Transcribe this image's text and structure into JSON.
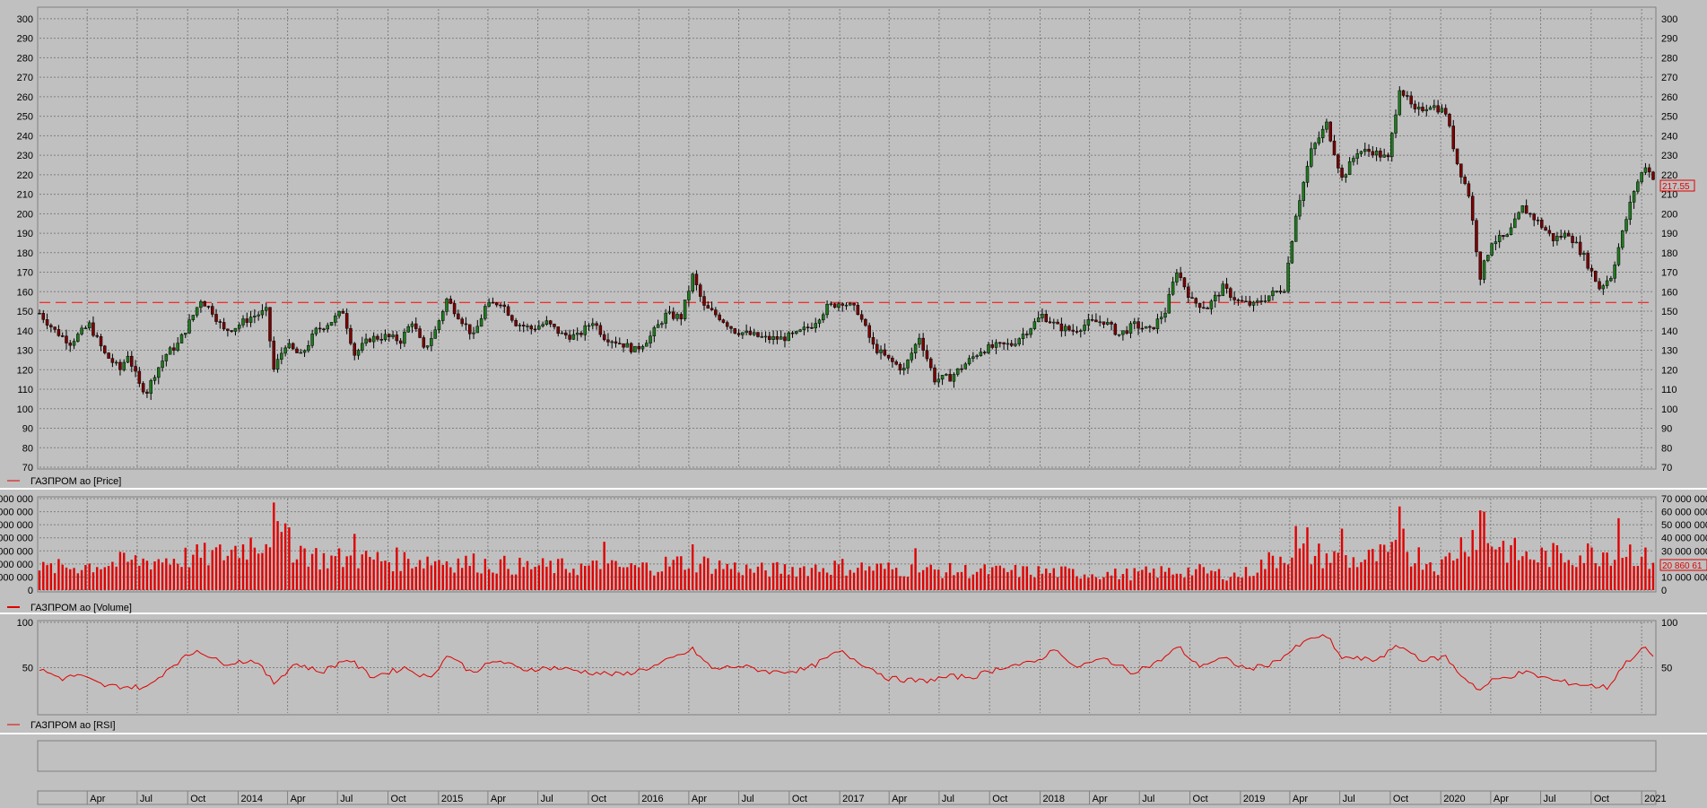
{
  "colors": {
    "background": "#c0c0c0",
    "panel": "#c0c0c0",
    "grid": "#7f7f7f",
    "candle_up": "#1f7a1f",
    "candle_down": "#7a0000",
    "wick": "#000000",
    "volume": "#e00000",
    "rsi_line": "#e00000",
    "reference_line": "#ff0000",
    "last_value": "#e00000"
  },
  "chart_data": [
    {
      "type": "candlestick",
      "name": "ГАЗПРОМ ао [Price]",
      "legend": "ГАЗПРОМ ао [Price]",
      "ylim": [
        70,
        305
      ],
      "yticks": [
        70,
        80,
        90,
        100,
        110,
        120,
        130,
        140,
        150,
        160,
        170,
        180,
        190,
        200,
        210,
        220,
        230,
        240,
        250,
        260,
        270,
        280,
        290,
        300
      ],
      "reference_line": 154.5,
      "last_value_label": "217.55",
      "x_dates": [
        "2013-01-04",
        "2021-01-22"
      ],
      "close_path": [
        [
          "2013-01-04",
          149
        ],
        [
          "2013-02-01",
          140
        ],
        [
          "2013-03-01",
          134
        ],
        [
          "2013-04-05",
          143
        ],
        [
          "2013-05-03",
          128
        ],
        [
          "2013-05-31",
          120
        ],
        [
          "2013-06-14",
          128
        ],
        [
          "2013-07-05",
          112
        ],
        [
          "2013-07-19",
          109
        ],
        [
          "2013-08-02",
          118
        ],
        [
          "2013-08-23",
          128
        ],
        [
          "2013-09-13",
          133
        ],
        [
          "2013-10-11",
          148
        ],
        [
          "2013-10-25",
          156
        ],
        [
          "2013-11-15",
          150
        ],
        [
          "2013-12-06",
          140
        ],
        [
          "2013-12-27",
          142
        ],
        [
          "2014-01-24",
          147
        ],
        [
          "2014-02-21",
          150
        ],
        [
          "2014-03-07",
          120
        ],
        [
          "2014-03-28",
          133
        ],
        [
          "2014-04-25",
          127
        ],
        [
          "2014-05-23",
          140
        ],
        [
          "2014-06-20",
          145
        ],
        [
          "2014-07-11",
          150
        ],
        [
          "2014-08-01",
          128
        ],
        [
          "2014-08-29",
          136
        ],
        [
          "2014-09-26",
          137
        ],
        [
          "2014-10-24",
          135
        ],
        [
          "2014-11-14",
          145
        ],
        [
          "2014-12-05",
          130
        ],
        [
          "2014-12-26",
          140
        ],
        [
          "2015-01-16",
          156
        ],
        [
          "2015-02-06",
          148
        ],
        [
          "2015-03-06",
          137
        ],
        [
          "2015-03-27",
          152
        ],
        [
          "2015-04-24",
          155
        ],
        [
          "2015-05-22",
          144
        ],
        [
          "2015-06-19",
          141
        ],
        [
          "2015-07-17",
          144
        ],
        [
          "2015-08-14",
          138
        ],
        [
          "2015-09-11",
          137
        ],
        [
          "2015-10-09",
          145
        ],
        [
          "2015-10-30",
          137
        ],
        [
          "2015-12-04",
          133
        ],
        [
          "2015-12-25",
          130
        ],
        [
          "2016-01-22",
          137
        ],
        [
          "2016-02-19",
          148
        ],
        [
          "2016-03-18",
          147
        ],
        [
          "2016-04-08",
          168
        ],
        [
          "2016-04-29",
          152
        ],
        [
          "2016-05-27",
          147
        ],
        [
          "2016-06-24",
          140
        ],
        [
          "2016-07-22",
          138
        ],
        [
          "2016-08-19",
          136
        ],
        [
          "2016-09-16",
          136
        ],
        [
          "2016-10-14",
          138
        ],
        [
          "2016-11-11",
          143
        ],
        [
          "2016-12-09",
          152
        ],
        [
          "2017-01-06",
          155
        ],
        [
          "2017-02-03",
          150
        ],
        [
          "2017-03-03",
          132
        ],
        [
          "2017-03-31",
          125
        ],
        [
          "2017-04-28",
          120
        ],
        [
          "2017-05-26",
          137
        ],
        [
          "2017-06-23",
          115
        ],
        [
          "2017-07-21",
          116
        ],
        [
          "2017-08-18",
          123
        ],
        [
          "2017-09-15",
          130
        ],
        [
          "2017-10-13",
          132
        ],
        [
          "2017-11-10",
          133
        ],
        [
          "2017-12-08",
          140
        ],
        [
          "2018-01-05",
          148
        ],
        [
          "2018-02-02",
          142
        ],
        [
          "2018-03-02",
          140
        ],
        [
          "2018-03-30",
          144
        ],
        [
          "2018-04-27",
          145
        ],
        [
          "2018-05-25",
          138
        ],
        [
          "2018-06-22",
          143
        ],
        [
          "2018-07-20",
          140
        ],
        [
          "2018-08-17",
          150
        ],
        [
          "2018-09-07",
          171
        ],
        [
          "2018-10-05",
          155
        ],
        [
          "2018-11-02",
          152
        ],
        [
          "2018-11-30",
          162
        ],
        [
          "2018-12-28",
          155
        ],
        [
          "2019-01-25",
          153
        ],
        [
          "2019-02-22",
          158
        ],
        [
          "2019-03-22",
          162
        ],
        [
          "2019-04-12",
          200
        ],
        [
          "2019-05-10",
          232
        ],
        [
          "2019-06-07",
          246
        ],
        [
          "2019-07-05",
          218
        ],
        [
          "2019-08-02",
          232
        ],
        [
          "2019-08-30",
          232
        ],
        [
          "2019-09-27",
          228
        ],
        [
          "2019-10-18",
          265
        ],
        [
          "2019-11-15",
          252
        ],
        [
          "2019-12-13",
          256
        ],
        [
          "2020-01-10",
          252
        ],
        [
          "2020-01-31",
          226
        ],
        [
          "2020-02-21",
          210
        ],
        [
          "2020-03-13",
          168
        ],
        [
          "2020-04-03",
          186
        ],
        [
          "2020-05-01",
          188
        ],
        [
          "2020-05-29",
          203
        ],
        [
          "2020-06-26",
          196
        ],
        [
          "2020-07-24",
          187
        ],
        [
          "2020-08-21",
          190
        ],
        [
          "2020-09-18",
          178
        ],
        [
          "2020-10-16",
          162
        ],
        [
          "2020-11-06",
          168
        ],
        [
          "2020-11-27",
          190
        ],
        [
          "2020-12-18",
          212
        ],
        [
          "2021-01-08",
          225
        ],
        [
          "2021-01-22",
          217.55
        ]
      ]
    },
    {
      "type": "bar",
      "name": "ГАЗПРОМ ао [Volume]",
      "legend": "ГАЗПРОМ ао [Volume]",
      "ylim": [
        0,
        70000000
      ],
      "yticks": [
        0,
        10000000,
        20000000,
        30000000,
        40000000,
        50000000,
        60000000,
        70000000
      ],
      "ytick_labels": [
        "0",
        "10 000 000",
        "20 000 000",
        "30 000 000",
        "40 000 000",
        "50 000 000",
        "60 000 000",
        "70 000 000"
      ],
      "last_value_label": "20 860 61",
      "level_path": [
        [
          "2013-01-04",
          16000000
        ],
        [
          "2013-06-01",
          21000000
        ],
        [
          "2013-12-01",
          27000000
        ],
        [
          "2014-03-01",
          42000000
        ],
        [
          "2014-06-01",
          24000000
        ],
        [
          "2015-01-01",
          23000000
        ],
        [
          "2015-06-01",
          18000000
        ],
        [
          "2016-01-01",
          17000000
        ],
        [
          "2016-04-01",
          22000000
        ],
        [
          "2016-08-01",
          15000000
        ],
        [
          "2017-01-01",
          18000000
        ],
        [
          "2017-06-01",
          15000000
        ],
        [
          "2018-01-01",
          14000000
        ],
        [
          "2018-06-01",
          12000000
        ],
        [
          "2018-10-01",
          15000000
        ],
        [
          "2019-01-01",
          11000000
        ],
        [
          "2019-04-01",
          30000000
        ],
        [
          "2019-08-01",
          22000000
        ],
        [
          "2019-11-01",
          30000000
        ],
        [
          "2020-01-01",
          18000000
        ],
        [
          "2020-03-01",
          45000000
        ],
        [
          "2020-06-01",
          25000000
        ],
        [
          "2020-10-01",
          28000000
        ],
        [
          "2020-12-01",
          32000000
        ],
        [
          "2021-01-22",
          20860610
        ]
      ],
      "peaks": [
        [
          "2014-03-07",
          67000000
        ],
        [
          "2014-04-04",
          48000000
        ],
        [
          "2014-08-01",
          43000000
        ],
        [
          "2015-10-30",
          37000000
        ],
        [
          "2016-04-08",
          35000000
        ],
        [
          "2017-05-19",
          32000000
        ],
        [
          "2019-04-12",
          49000000
        ],
        [
          "2019-05-03",
          48000000
        ],
        [
          "2019-07-05",
          47000000
        ],
        [
          "2019-10-18",
          64000000
        ],
        [
          "2019-10-25",
          47000000
        ],
        [
          "2020-03-13",
          61000000
        ],
        [
          "2020-03-20",
          60000000
        ],
        [
          "2020-11-20",
          55000000
        ]
      ]
    },
    {
      "type": "line",
      "name": "ГАЗПРОМ ао [RSI]",
      "legend": "ГАЗПРОМ ао [RSI]",
      "ylim": [
        0,
        100
      ],
      "yticks": [
        50,
        100
      ],
      "values_path": [
        [
          "2013-01-04",
          48
        ],
        [
          "2013-02-15",
          38
        ],
        [
          "2013-03-15",
          42
        ],
        [
          "2013-05-01",
          30
        ],
        [
          "2013-07-20",
          28
        ],
        [
          "2013-09-01",
          52
        ],
        [
          "2013-10-20",
          70
        ],
        [
          "2013-12-01",
          55
        ],
        [
          "2014-02-01",
          58
        ],
        [
          "2014-03-07",
          33
        ],
        [
          "2014-04-15",
          55
        ],
        [
          "2014-06-01",
          45
        ],
        [
          "2014-07-20",
          60
        ],
        [
          "2014-09-01",
          40
        ],
        [
          "2014-11-01",
          50
        ],
        [
          "2014-12-15",
          38
        ],
        [
          "2015-01-20",
          65
        ],
        [
          "2015-03-01",
          45
        ],
        [
          "2015-04-20",
          58
        ],
        [
          "2015-06-01",
          48
        ],
        [
          "2015-08-01",
          50
        ],
        [
          "2015-10-01",
          45
        ],
        [
          "2015-12-01",
          42
        ],
        [
          "2016-02-01",
          52
        ],
        [
          "2016-04-08",
          70
        ],
        [
          "2016-05-15",
          48
        ],
        [
          "2016-07-01",
          52
        ],
        [
          "2016-09-01",
          45
        ],
        [
          "2016-11-01",
          48
        ],
        [
          "2017-01-01",
          68
        ],
        [
          "2017-02-01",
          58
        ],
        [
          "2017-04-01",
          38
        ],
        [
          "2017-06-01",
          35
        ],
        [
          "2017-07-20",
          40
        ],
        [
          "2017-09-01",
          40
        ],
        [
          "2017-11-01",
          52
        ],
        [
          "2017-12-20",
          55
        ],
        [
          "2018-02-01",
          72
        ],
        [
          "2018-03-01",
          50
        ],
        [
          "2018-05-01",
          60
        ],
        [
          "2018-06-15",
          45
        ],
        [
          "2018-08-01",
          55
        ],
        [
          "2018-09-10",
          73
        ],
        [
          "2018-10-15",
          52
        ],
        [
          "2018-12-01",
          60
        ],
        [
          "2019-01-15",
          48
        ],
        [
          "2019-03-01",
          55
        ],
        [
          "2019-04-20",
          75
        ],
        [
          "2019-05-20",
          85
        ],
        [
          "2019-06-10",
          83
        ],
        [
          "2019-07-01",
          62
        ],
        [
          "2019-09-01",
          58
        ],
        [
          "2019-10-18",
          74
        ],
        [
          "2019-12-01",
          58
        ],
        [
          "2020-01-10",
          62
        ],
        [
          "2020-02-01",
          45
        ],
        [
          "2020-03-13",
          25
        ],
        [
          "2020-04-01",
          35
        ],
        [
          "2020-06-01",
          45
        ],
        [
          "2020-08-01",
          35
        ],
        [
          "2020-10-01",
          30
        ],
        [
          "2020-11-01",
          28
        ],
        [
          "2020-11-25",
          50
        ],
        [
          "2020-12-15",
          62
        ],
        [
          "2021-01-08",
          72
        ],
        [
          "2021-01-22",
          62
        ]
      ]
    }
  ],
  "time_axis": {
    "labels": [
      [
        "2013-04-01",
        "Apr"
      ],
      [
        "2013-07-01",
        "Jul"
      ],
      [
        "2013-10-01",
        "Oct"
      ],
      [
        "2014-01-01",
        "2014"
      ],
      [
        "2014-04-01",
        "Apr"
      ],
      [
        "2014-07-01",
        "Jul"
      ],
      [
        "2014-10-01",
        "Oct"
      ],
      [
        "2015-01-01",
        "2015"
      ],
      [
        "2015-04-01",
        "Apr"
      ],
      [
        "2015-07-01",
        "Jul"
      ],
      [
        "2015-10-01",
        "Oct"
      ],
      [
        "2016-01-01",
        "2016"
      ],
      [
        "2016-04-01",
        "Apr"
      ],
      [
        "2016-07-01",
        "Jul"
      ],
      [
        "2016-10-01",
        "Oct"
      ],
      [
        "2017-01-01",
        "2017"
      ],
      [
        "2017-04-01",
        "Apr"
      ],
      [
        "2017-07-01",
        "Jul"
      ],
      [
        "2017-10-01",
        "Oct"
      ],
      [
        "2018-01-01",
        "2018"
      ],
      [
        "2018-04-01",
        "Apr"
      ],
      [
        "2018-07-01",
        "Jul"
      ],
      [
        "2018-10-01",
        "Oct"
      ],
      [
        "2019-01-01",
        "2019"
      ],
      [
        "2019-04-01",
        "Apr"
      ],
      [
        "2019-07-01",
        "Jul"
      ],
      [
        "2019-10-01",
        "Oct"
      ],
      [
        "2020-01-01",
        "2020"
      ],
      [
        "2020-04-01",
        "Apr"
      ],
      [
        "2020-07-01",
        "Jul"
      ],
      [
        "2020-10-01",
        "Oct"
      ],
      [
        "2021-01-01",
        "2021"
      ]
    ]
  }
}
